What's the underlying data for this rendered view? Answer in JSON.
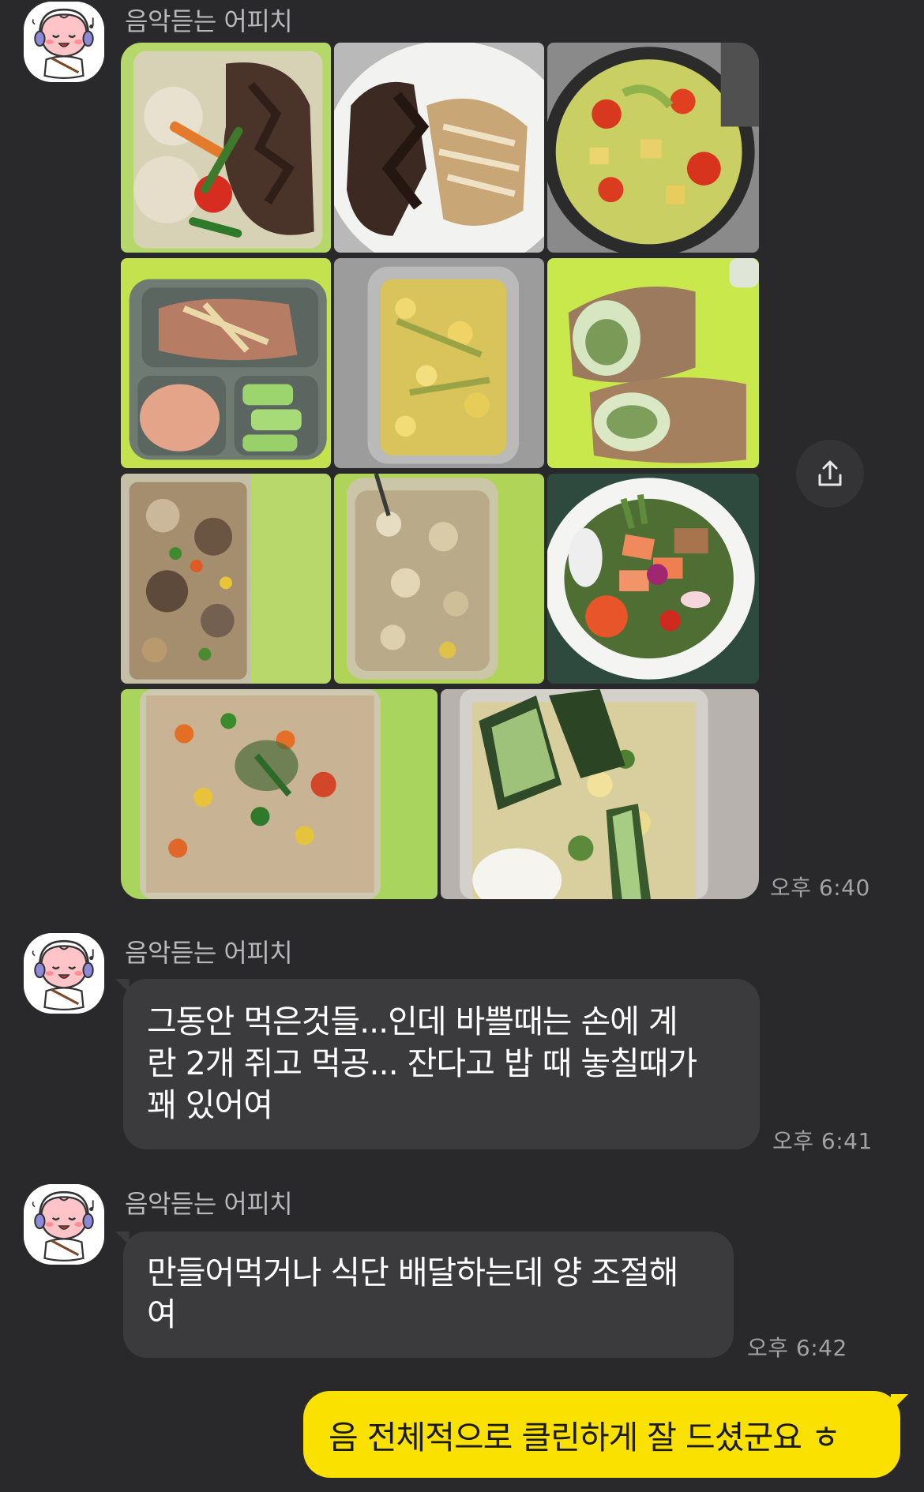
{
  "colors": {
    "background": "#29292b",
    "incoming_bubble": "#3b3b3e",
    "outgoing_bubble": "#fae100",
    "sender_text": "#b9b9bc",
    "timestamp_text": "#a3a3a6"
  },
  "messages": [
    {
      "sender": "음악듣는 어피치",
      "type": "photo-album",
      "photo_count": 11,
      "photos": [
        {
          "subject": "steak rice box"
        },
        {
          "subject": "steak and mushrooms"
        },
        {
          "subject": "stir-fried vegetables in pan"
        },
        {
          "subject": "divided plate meal"
        },
        {
          "subject": "scrambled egg container"
        },
        {
          "subject": "wraps"
        },
        {
          "subject": "beef rice container"
        },
        {
          "subject": "rice and egg container"
        },
        {
          "subject": "salmon poke salad"
        },
        {
          "subject": "vegetable fried rice"
        },
        {
          "subject": "cucumber egg salad"
        }
      ],
      "time": "오후 6:40"
    },
    {
      "sender": "음악듣는 어피치",
      "type": "text",
      "lines": [
        "그동안 먹은것들...인데 바쁠때는 손에 계",
        "란 2개 쥐고 먹공... 잔다고 밥 때 놓칠때가",
        "꽤 있어여"
      ],
      "time": "오후 6:41"
    },
    {
      "sender": "음악듣는 어피치",
      "type": "text",
      "lines": [
        "만들어먹거나 식단 배달하는데 양 조절해",
        "여"
      ],
      "time": "오후 6:42"
    },
    {
      "sender": "me",
      "type": "text",
      "text": "음 전체적으로 클린하게 잘 드셨군요 ㅎ"
    }
  ],
  "icons": {
    "share": "share-icon",
    "avatar": "apeach-avatar-icon"
  }
}
